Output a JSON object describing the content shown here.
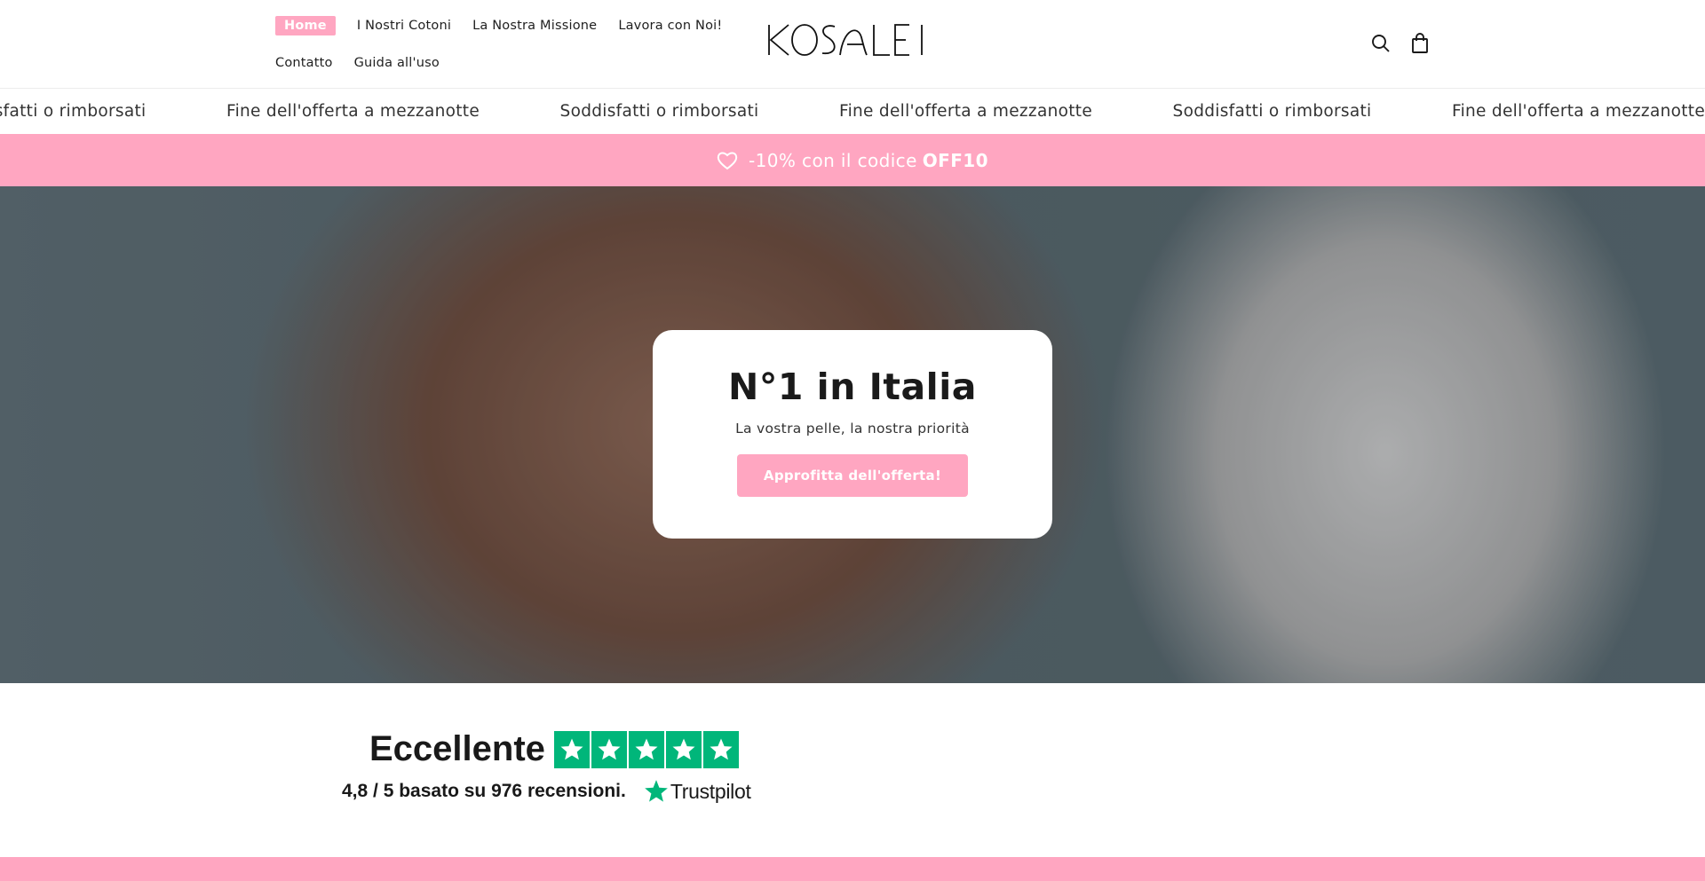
{
  "nav": {
    "items": [
      {
        "label": "Home",
        "active": true
      },
      {
        "label": "I Nostri Cotoni"
      },
      {
        "label": "La Nostra Missione"
      },
      {
        "label": "Lavora con Noi!"
      },
      {
        "label": "Contatto"
      },
      {
        "label": "Guida all'uso"
      }
    ]
  },
  "header": {
    "logo_icon": "kosalei-logo",
    "search_icon": "search-icon",
    "cart_icon": "shopping-bag-icon"
  },
  "marquee": {
    "items": [
      "Soddisfatti o rimborsati",
      "Fine dell'offerta a mezzanotte",
      "Soddisfatti o rimborsati",
      "Fine dell'offerta a mezzanotte",
      "Soddisfatti o rimborsati",
      "Fine dell'offerta a mezzanotte"
    ]
  },
  "promo": {
    "icon": "heart-icon",
    "text": "-10% con il codice",
    "code": "OFF10"
  },
  "hero": {
    "title": "N°1 in Italia",
    "subtitle": "La vostra pelle, la nostra priorità",
    "cta": "Approfitta dell'offerta!"
  },
  "trust": {
    "label": "Eccellente",
    "stars": 5,
    "rating_text": "4,8 / 5 basato su 976 recensioni.",
    "brand": "Trustpilot"
  },
  "colors": {
    "accent_pink": "#ffa6c1",
    "trustpilot_green": "#00b67a"
  }
}
